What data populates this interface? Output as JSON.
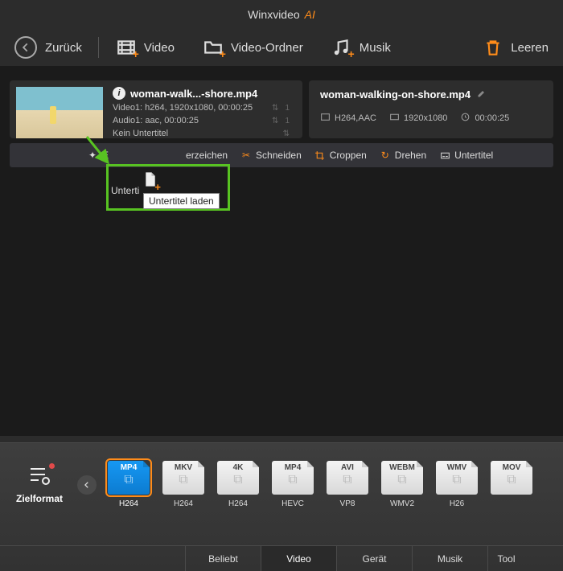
{
  "app": {
    "title": "Winxvideo",
    "title_suffix": "AI"
  },
  "toolbar": {
    "back": "Zurück",
    "video": "Video",
    "video_folder": "Video-Ordner",
    "music": "Musik",
    "clear": "Leeren"
  },
  "file_item": {
    "title": "woman-walk...-shore.mp4",
    "video_line": "Video1: h264, 1920x1080, 00:00:25",
    "audio_line": "Audio1: aac, 00:00:25",
    "subtitle_line": "Kein Untertitel",
    "video_count": "1",
    "audio_count": "1"
  },
  "output_item": {
    "title": "woman-walking-on-shore.mp4",
    "codec": "H264,AAC",
    "resolution": "1920x1080",
    "duration": "00:00:25"
  },
  "actions": {
    "effect_partial": "E",
    "water_partial": "erzeichen",
    "cut": "Schneiden",
    "crop": "Croppen",
    "rotate": "Drehen",
    "subtitle": "Untertitel"
  },
  "popup": {
    "chip_label_partial": "Unterti",
    "tooltip": "Untertitel laden"
  },
  "bottom": {
    "target_format": "Zielformat",
    "formats": [
      {
        "top": "MP4",
        "label": "H264",
        "selected": true
      },
      {
        "top": "MKV",
        "label": "H264",
        "selected": false
      },
      {
        "top": "4K",
        "label": "H264",
        "selected": false
      },
      {
        "top": "MP4",
        "label": "HEVC",
        "selected": false
      },
      {
        "top": "AVI",
        "label": "VP8",
        "selected": false
      },
      {
        "top": "WEBM",
        "label": "WMV2",
        "selected": false
      },
      {
        "top": "WMV",
        "label": "H26",
        "selected": false
      },
      {
        "top": "MOV",
        "label": "",
        "selected": false
      }
    ],
    "tabs": {
      "popular": "Beliebt",
      "video": "Video",
      "device": "Gerät",
      "music": "Musik",
      "toolbox_partial": "Tool"
    }
  }
}
